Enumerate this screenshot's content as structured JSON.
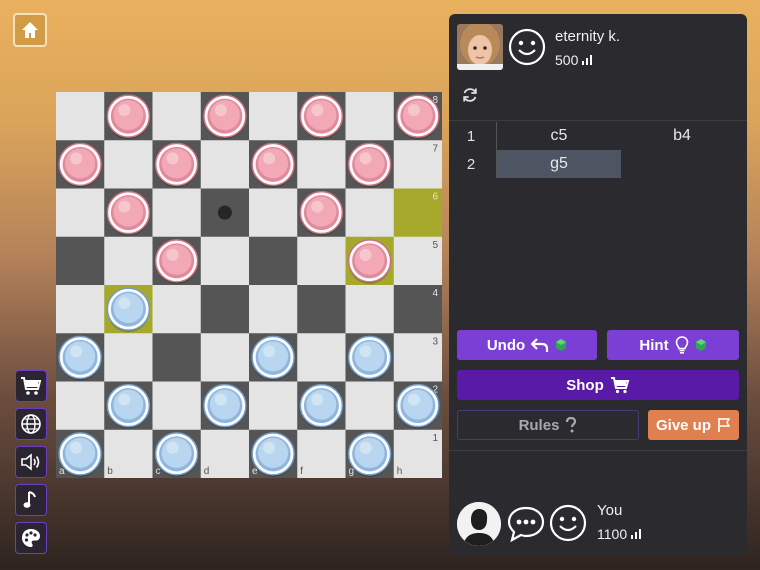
{
  "home": {
    "icon": "home-icon"
  },
  "board": {
    "files": [
      "a",
      "b",
      "c",
      "d",
      "e",
      "f",
      "g",
      "h"
    ],
    "ranks": [
      "8",
      "7",
      "6",
      "5",
      "4",
      "3",
      "2",
      "1"
    ],
    "colors": {
      "light": "#e4e4e4",
      "dark": "#555555",
      "highlight": "#bcbf3a",
      "highlight_dark": "#a6a82c",
      "pink": "#f2a8b5",
      "blue": "#b8d6ef"
    },
    "pieces": [
      {
        "sq": "b8",
        "color": "pink"
      },
      {
        "sq": "d8",
        "color": "pink"
      },
      {
        "sq": "f8",
        "color": "pink"
      },
      {
        "sq": "h8",
        "color": "pink"
      },
      {
        "sq": "a7",
        "color": "pink"
      },
      {
        "sq": "c7",
        "color": "pink"
      },
      {
        "sq": "e7",
        "color": "pink"
      },
      {
        "sq": "g7",
        "color": "pink"
      },
      {
        "sq": "b6",
        "color": "pink"
      },
      {
        "sq": "f6",
        "color": "pink"
      },
      {
        "sq": "c5",
        "color": "pink"
      },
      {
        "sq": "g5",
        "color": "pink"
      },
      {
        "sq": "b4",
        "color": "blue"
      },
      {
        "sq": "a3",
        "color": "blue"
      },
      {
        "sq": "e3",
        "color": "blue"
      },
      {
        "sq": "g3",
        "color": "blue"
      },
      {
        "sq": "b2",
        "color": "blue"
      },
      {
        "sq": "d2",
        "color": "blue"
      },
      {
        "sq": "f2",
        "color": "blue"
      },
      {
        "sq": "h2",
        "color": "blue"
      },
      {
        "sq": "a1",
        "color": "blue"
      },
      {
        "sq": "c1",
        "color": "blue"
      },
      {
        "sq": "e1",
        "color": "blue"
      },
      {
        "sq": "g1",
        "color": "blue"
      }
    ],
    "highlights": [
      "h6",
      "g5",
      "b4"
    ],
    "move_dots": [
      "d6"
    ]
  },
  "side_menu": [
    {
      "name": "shop-cart",
      "icon": "cart-icon"
    },
    {
      "name": "language",
      "icon": "globe-icon"
    },
    {
      "name": "sound",
      "icon": "speaker-icon"
    },
    {
      "name": "music",
      "icon": "music-note-icon"
    },
    {
      "name": "theme",
      "icon": "palette-icon"
    }
  ],
  "opponent": {
    "name": "eternity k.",
    "rating": "500"
  },
  "moves": [
    {
      "num": "1",
      "white": "c5",
      "black": "b4"
    },
    {
      "num": "2",
      "white": "g5",
      "black": ""
    }
  ],
  "buttons": {
    "undo": "Undo",
    "hint": "Hint",
    "shop": "Shop",
    "rules": "Rules",
    "give_up": "Give up"
  },
  "player": {
    "name": "You",
    "rating": "1100"
  }
}
